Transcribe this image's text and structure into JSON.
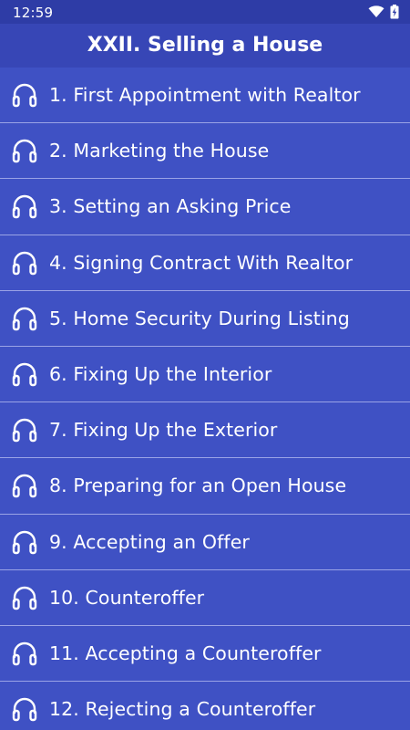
{
  "status_bar": {
    "time": "12:59",
    "icons": [
      "wifi-icon",
      "battery-charging-icon"
    ]
  },
  "app_bar": {
    "title": "XXII. Selling a House"
  },
  "lessons": [
    {
      "label": "1. First Appointment with Realtor",
      "icon": "headphones-icon"
    },
    {
      "label": "2. Marketing the House",
      "icon": "headphones-icon"
    },
    {
      "label": "3. Setting an Asking Price",
      "icon": "headphones-icon"
    },
    {
      "label": "4. Signing Contract With Realtor",
      "icon": "headphones-icon"
    },
    {
      "label": "5. Home Security During Listing",
      "icon": "headphones-icon"
    },
    {
      "label": "6. Fixing Up the Interior",
      "icon": "headphones-icon"
    },
    {
      "label": "7. Fixing Up the Exterior",
      "icon": "headphones-icon"
    },
    {
      "label": "8. Preparing for an Open House",
      "icon": "headphones-icon"
    },
    {
      "label": "9. Accepting an Offer",
      "icon": "headphones-icon"
    },
    {
      "label": "10. Counteroffer",
      "icon": "headphones-icon"
    },
    {
      "label": "11. Accepting a Counteroffer",
      "icon": "headphones-icon"
    },
    {
      "label": "12. Rejecting a Counteroffer",
      "icon": "headphones-icon"
    }
  ],
  "colors": {
    "status_bar": "#2E3CA6",
    "app_bar": "#3746B6",
    "list_background": "#3F51C4",
    "divider": "#9AA3E6",
    "text": "#FFFFFF"
  }
}
